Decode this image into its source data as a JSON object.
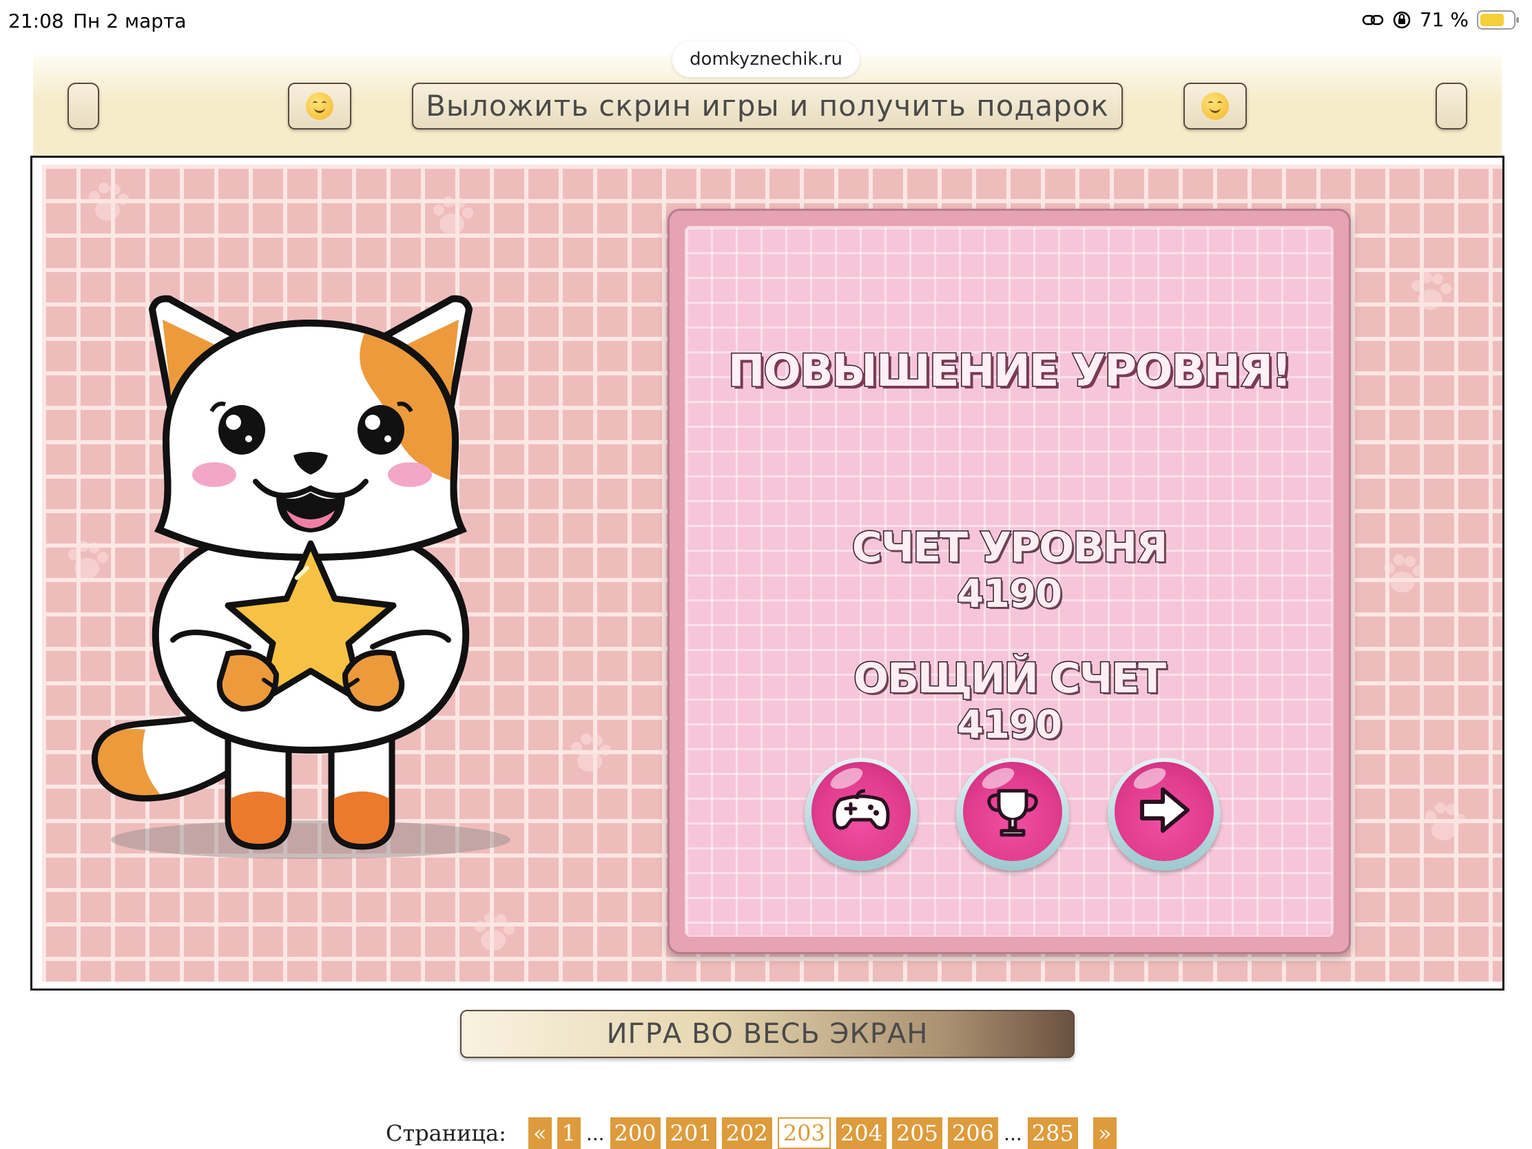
{
  "status_bar": {
    "time": "21:08",
    "date": "Пн 2 марта",
    "battery_percent": "71 %",
    "battery_level": 0.71
  },
  "browser": {
    "url": "domkyznechik.ru"
  },
  "promo": {
    "main_label": "Выложить скрин игры и получить подарок",
    "emoji_icon": "hugging-face-emoji"
  },
  "game": {
    "modal": {
      "title": "ПОВЫШЕНИЕ УРОВНЯ!",
      "level_score_label": "СЧЕТ УРОВНЯ",
      "level_score_value": "4190",
      "total_score_label": "ОБЩИЙ СЧЕТ",
      "total_score_value": "4190",
      "buttons": [
        {
          "icon": "gamepad-icon"
        },
        {
          "icon": "trophy-icon"
        },
        {
          "icon": "arrow-right-icon"
        }
      ]
    },
    "colors": {
      "background_pink": "#efbcbc",
      "modal_pink": "#f6c6d8",
      "button_magenta": "#e23d8f",
      "cat_orange": "#ec9a3c"
    }
  },
  "fullscreen_button": {
    "label": "ИГРА ВО ВЕСЬ ЭКРАН"
  },
  "pagination": {
    "label": "Страница:",
    "prev": "«",
    "first": "1",
    "ellipsis": "...",
    "pages": [
      "200",
      "201",
      "202",
      "203",
      "204",
      "205",
      "206"
    ],
    "current": "203",
    "last": "285",
    "next": "»",
    "accent_color": "#dd9b3c"
  }
}
